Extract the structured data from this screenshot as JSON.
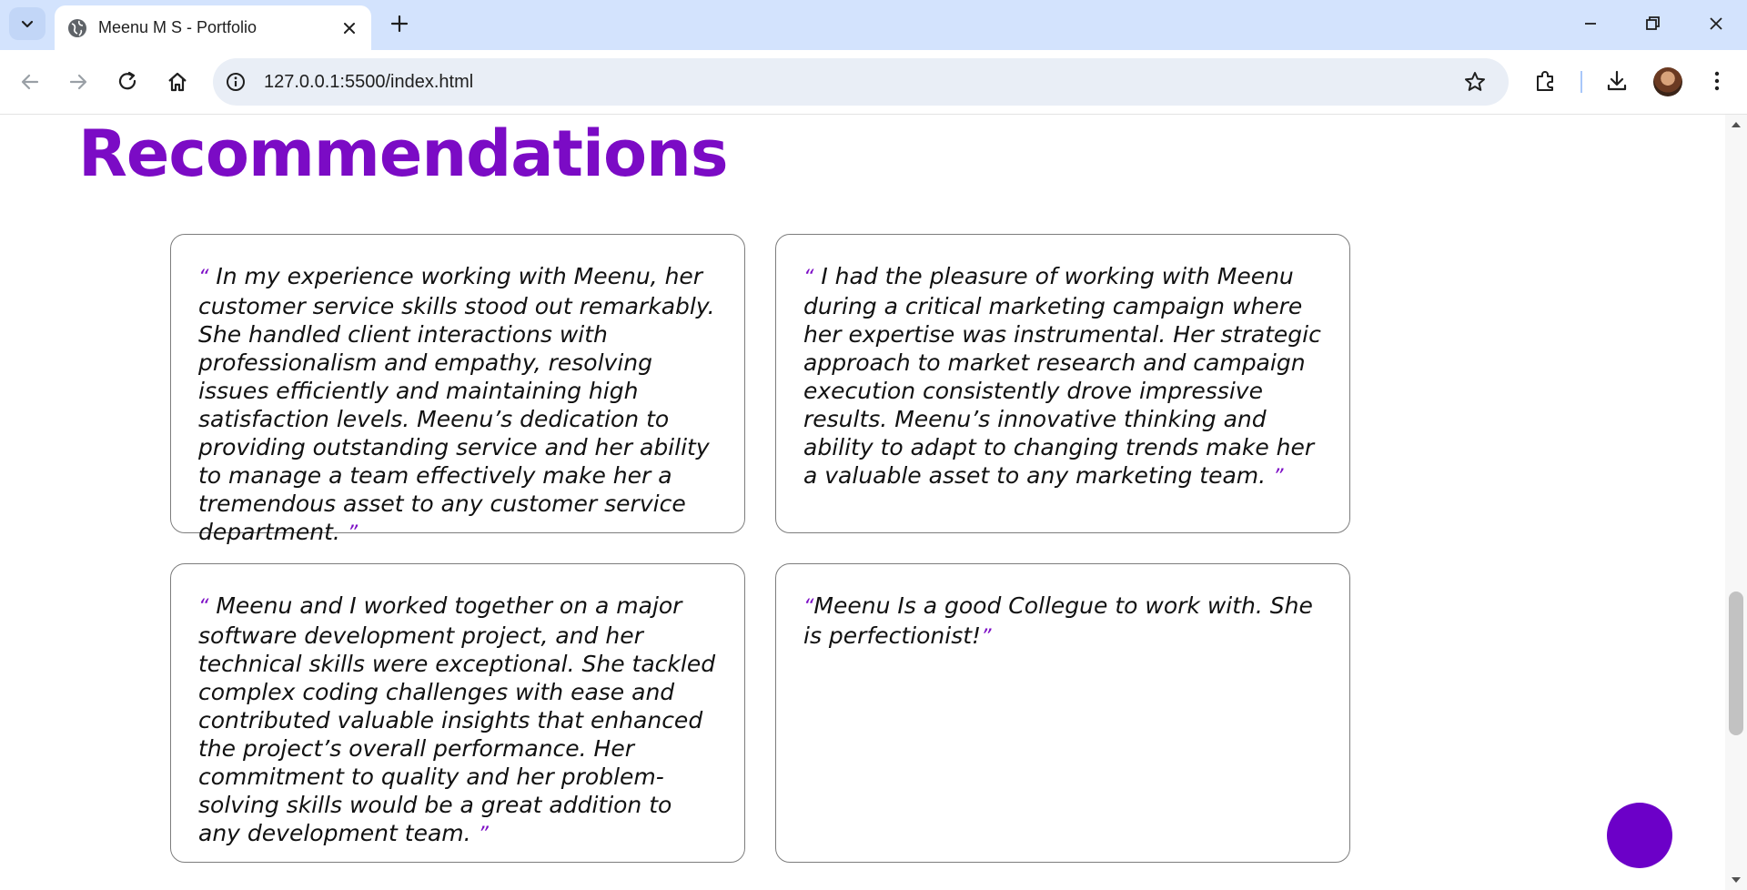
{
  "browser": {
    "tab_title": "Meenu M S - Portfolio",
    "url": "127.0.0.1:5500/index.html"
  },
  "page": {
    "heading": "Recommendations",
    "recommendations": [
      {
        "open_quote": "“",
        "text": " In my experience working with Meenu, her customer service skills stood out remarkably. She handled client interactions with professionalism and empathy, resolving issues efficiently and maintaining high satisfaction levels. Meenu’s dedication to providing outstanding service and her ability to manage a team effectively make her a tremendous asset to any customer service department. ",
        "close_quote": "”"
      },
      {
        "open_quote": "“",
        "text": " I had the pleasure of working with Meenu during a critical marketing campaign where her expertise was instrumental. Her strategic approach to market research and campaign execution consistently drove impressive results. Meenu’s innovative thinking and ability to adapt to changing trends make her a valuable asset to any marketing team. ",
        "close_quote": "”"
      },
      {
        "open_quote": "“",
        "text": " Meenu and I worked together on a major software development project, and her technical skills were exceptional. She tackled complex coding challenges with ease and contributed valuable insights that enhanced the project’s overall performance. Her commitment to quality and her problem-solving skills would be a great addition to any development team. ",
        "close_quote": "”"
      },
      {
        "open_quote": "“",
        "text": "Meenu Is a good Collegue to work with. She is perfectionist!",
        "close_quote": "”"
      }
    ]
  },
  "colors": {
    "accent": "#7b0bc5",
    "fab": "#6c00c8",
    "tabstrip": "#d3e3fd"
  },
  "icons": {
    "tab_search": "chevron-down-icon",
    "favicon": "globe-icon",
    "close": "close-icon",
    "new_tab": "plus-icon",
    "back": "arrow-left-icon",
    "forward": "arrow-right-icon",
    "reload": "reload-icon",
    "home": "home-icon",
    "site_info": "info-icon",
    "bookmark": "star-icon",
    "extensions": "puzzle-icon",
    "downloads": "download-icon",
    "menu": "kebab-menu-icon"
  }
}
